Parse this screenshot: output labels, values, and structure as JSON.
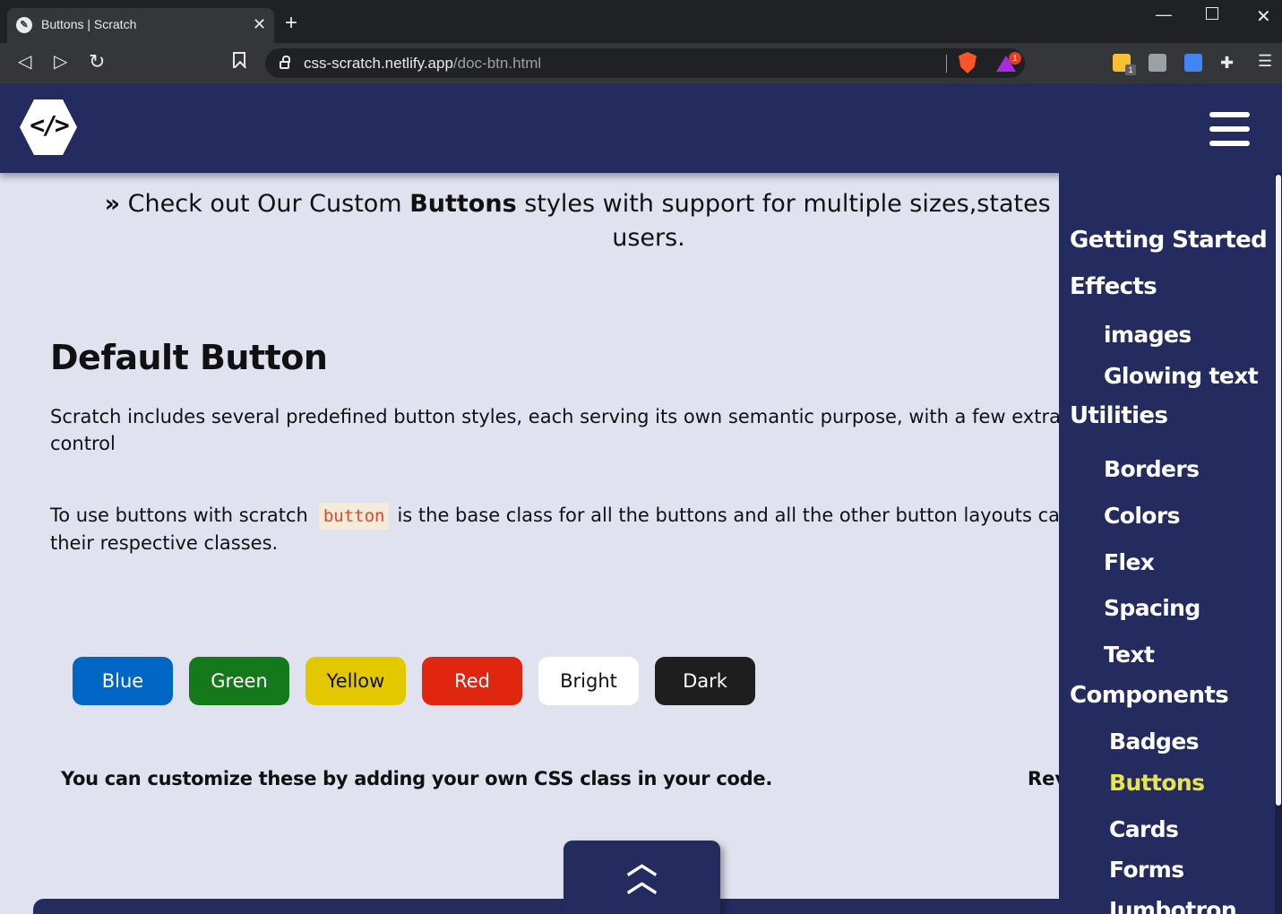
{
  "browser": {
    "tab_title": "Buttons | Scratch",
    "tab_close": "✕",
    "new_tab": "+",
    "url_host": "css-scratch.netlify.app",
    "url_path": "/doc-btn.html",
    "rewards_count": "1",
    "ext_badge": "1",
    "window_min": "—",
    "window_close": "✕"
  },
  "header": {
    "logo_glyph": "</>"
  },
  "main": {
    "intro_arrow": "»",
    "intro_pre": " Check out Our Custom ",
    "intro_bold": "Buttons",
    "intro_post": " styles with support for multiple sizes,states and easy C",
    "intro_line2": "users.",
    "section_title": "Default Button",
    "para1": "Scratch includes several predefined button styles, each serving its own semantic purpose, with a few extras thr",
    "para1_line2": "control",
    "para2_pre": "To use buttons with scratch",
    "para2_code": "button",
    "para2_post": "is the base class for all the buttons and all the other button layouts can be",
    "para2_line2": "their respective classes.",
    "buttons": [
      "Blue",
      "Green",
      "Yellow",
      "Red",
      "Bright",
      "Dark"
    ],
    "note": "You can customize these by adding your own CSS class in your code.",
    "note_right": "Rev",
    "to_top_icon": "⌃⌃"
  },
  "sidebar": {
    "getting_started": "Getting Started",
    "effects": "Effects",
    "images": "images",
    "glowing_text": "Glowing text",
    "utilities": "Utilities",
    "borders": "Borders",
    "colors": "Colors",
    "flex": "Flex",
    "spacing": "Spacing",
    "text": "Text",
    "components": "Components",
    "badges": "Badges",
    "buttons": "Buttons",
    "cards": "Cards",
    "forms": "Forms",
    "jumbotron": "Jumbotron"
  },
  "colors": {
    "header_bg": "#242b5e",
    "page_bg": "#e0e2f0",
    "active_link": "#e7e44c"
  }
}
